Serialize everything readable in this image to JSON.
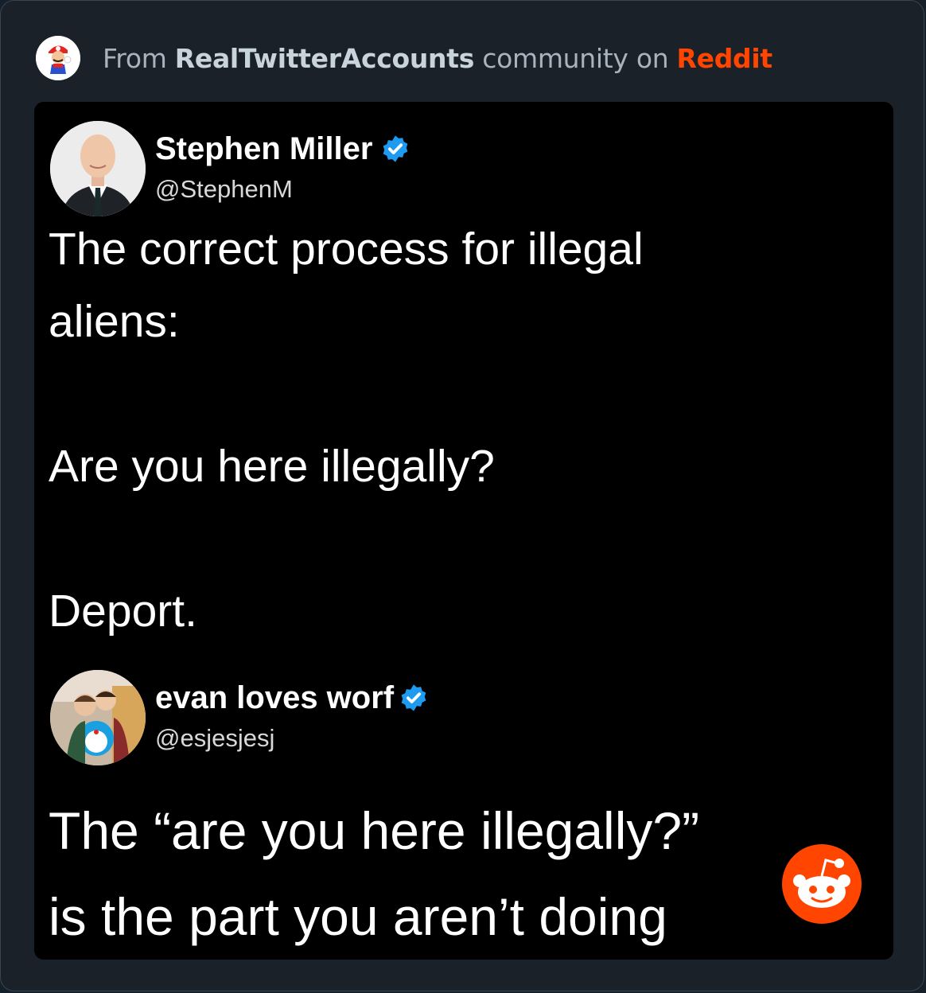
{
  "header": {
    "prefix": "From ",
    "community": "RealTwitterAccounts",
    "middle": " community on ",
    "platform": "Reddit"
  },
  "tweets": [
    {
      "display_name": "Stephen Miller",
      "handle": "@StephenM",
      "verified": true,
      "text": "The correct process for illegal\naliens:\n\nAre you here illegally?\n\nDeport."
    },
    {
      "display_name": "evan loves worf",
      "handle": "@esjesjesj",
      "verified": true,
      "text": "The “are you here illegally?”\nis the part you aren’t doing"
    }
  ],
  "colors": {
    "background": "#1a2128",
    "post_background": "#000000",
    "reddit_orange": "#ff4500",
    "verified_blue": "#1d9bf0"
  },
  "icons": {
    "community_avatar": "mario-avatar-icon",
    "verified": "verified-badge-icon",
    "watermark": "reddit-snoo-icon"
  }
}
